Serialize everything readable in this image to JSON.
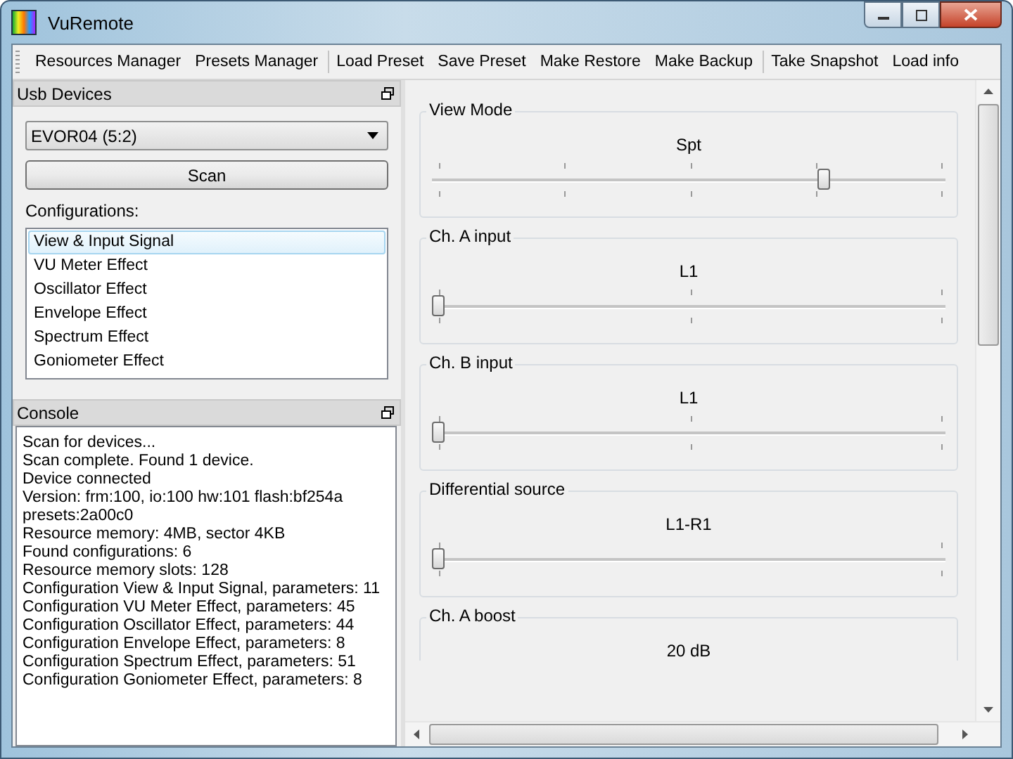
{
  "window": {
    "title": "VuRemote"
  },
  "toolbar": [
    {
      "label": "Resources Manager",
      "separator_before": false
    },
    {
      "label": "Presets Manager",
      "separator_before": false
    },
    {
      "label": "Load Preset",
      "separator_before": true
    },
    {
      "label": "Save Preset",
      "separator_before": false
    },
    {
      "label": "Make Restore",
      "separator_before": false
    },
    {
      "label": "Make Backup",
      "separator_before": false
    },
    {
      "label": "Take Snapshot",
      "separator_before": true
    },
    {
      "label": "Load info",
      "separator_before": false
    }
  ],
  "usb_devices": {
    "title": "Usb Devices",
    "device": "EVOR04 (5:2)",
    "scan_button": "Scan",
    "configurations_label": "Configurations:",
    "configurations": [
      {
        "label": "View & Input Signal",
        "selected": true
      },
      {
        "label": "VU Meter Effect",
        "selected": false
      },
      {
        "label": "Oscillator Effect",
        "selected": false
      },
      {
        "label": "Envelope Effect",
        "selected": false
      },
      {
        "label": "Spectrum Effect",
        "selected": false
      },
      {
        "label": "Goniometer Effect",
        "selected": false
      }
    ]
  },
  "console": {
    "title": "Console",
    "lines": [
      "Scan for devices...",
      "Scan complete. Found 1 device.",
      "Device connected",
      "Version: frm:100, io:100 hw:101 flash:bf254a",
      "presets:2a00c0",
      "Resource memory: 4MB, sector 4KB",
      "Found configurations: 6",
      "Resource memory slots: 128",
      "Configuration View & Input Signal, parameters: 11",
      "Configuration VU Meter Effect, parameters: 45",
      "Configuration Oscillator Effect, parameters: 44",
      "Configuration Envelope Effect, parameters: 8",
      "Configuration Spectrum Effect, parameters: 51",
      "Configuration Goniometer Effect, parameters: 8"
    ]
  },
  "parameters": [
    {
      "title": "View Mode",
      "value": "Spt",
      "kind": "five-step",
      "level": 0.75
    },
    {
      "title": "Ch. A input",
      "value": "L1",
      "kind": "three-step",
      "level": 0
    },
    {
      "title": "Ch. B input",
      "value": "L1",
      "kind": "three-step",
      "level": 0
    },
    {
      "title": "Differential source",
      "value": "L1-R1",
      "kind": "two-step",
      "level": 0
    },
    {
      "title": "Ch. A boost",
      "value": "20 dB",
      "kind": "none"
    }
  ]
}
